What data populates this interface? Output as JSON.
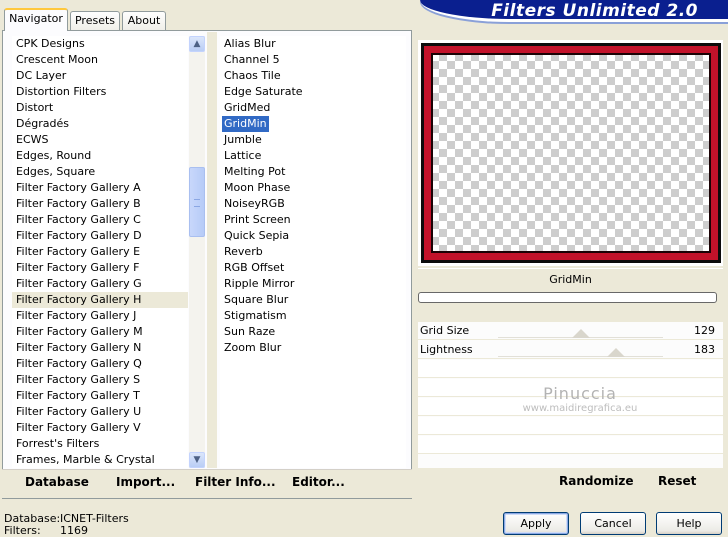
{
  "tabs": [
    {
      "label": "Navigator",
      "active": true
    },
    {
      "label": "Presets",
      "active": false
    },
    {
      "label": "About",
      "active": false
    }
  ],
  "banner_title": "Filters Unlimited 2.0",
  "categories": {
    "items": [
      "CPK Designs",
      "Crescent Moon",
      "DC Layer",
      "Distortion Filters",
      "Distort",
      "Dégradés",
      "ECWS",
      "Edges, Round",
      "Edges, Square",
      "Filter Factory Gallery A",
      "Filter Factory Gallery B",
      "Filter Factory Gallery C",
      "Filter Factory Gallery D",
      "Filter Factory Gallery E",
      "Filter Factory Gallery F",
      "Filter Factory Gallery G",
      "Filter Factory Gallery H",
      "Filter Factory Gallery J",
      "Filter Factory Gallery M",
      "Filter Factory Gallery N",
      "Filter Factory Gallery Q",
      "Filter Factory Gallery S",
      "Filter Factory Gallery T",
      "Filter Factory Gallery U",
      "Filter Factory Gallery V",
      "Forrest's Filters",
      "Frames, Marble & Crystal"
    ],
    "selected_index": 16
  },
  "filters": {
    "items": [
      "Alias Blur",
      "Channel 5",
      "Chaos Tile",
      "Edge Saturate",
      "GridMed",
      "GridMin",
      "Jumble",
      "Lattice",
      "Melting Pot",
      "Moon Phase",
      "NoiseyRGB",
      "Print Screen",
      "Quick Sepia",
      "Reverb",
      "RGB Offset",
      "Ripple Mirror",
      "Square Blur",
      "Stigmatism",
      "Sun Raze",
      "Zoom Blur"
    ],
    "selected_index": 5
  },
  "nav_buttons": {
    "database": "Database",
    "import": "Import...",
    "filter_info": "Filter Info...",
    "editor": "Editor..."
  },
  "filter_name": "GridMin",
  "progress": 0,
  "sliders": [
    {
      "label": "Grid Size",
      "value": 129,
      "max": 255
    },
    {
      "label": "Lightness",
      "value": 183,
      "max": 255
    }
  ],
  "watermark": {
    "name": "Pinuccia",
    "url": "www.maidiregrafica.eu"
  },
  "preview_buttons": {
    "randomize": "Randomize",
    "reset": "Reset"
  },
  "status": {
    "database_label": "Database:",
    "database_value": "ICNET-Filters",
    "filters_label": "Filters:",
    "filters_value": "1169"
  },
  "dialog_buttons": {
    "apply": "Apply",
    "cancel": "Cancel",
    "help": "Help"
  },
  "colors": {
    "accent": "#316ac5",
    "banner": "#0a1f8f",
    "frame": "#c2122a"
  }
}
